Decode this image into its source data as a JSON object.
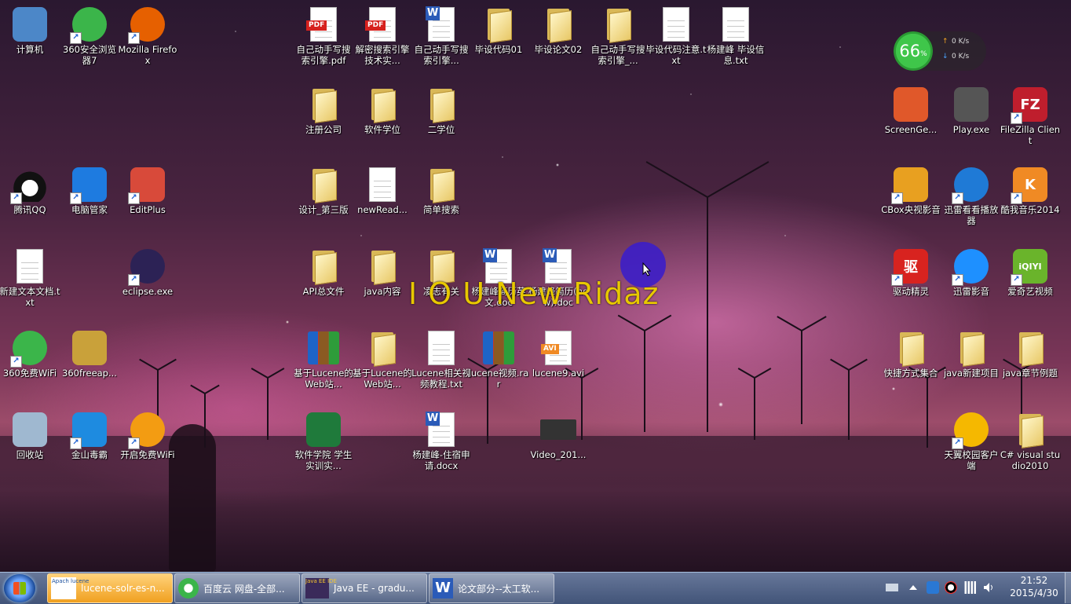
{
  "desktop": {
    "overlay_text": "I O U New Ridaz",
    "left_column": [
      {
        "label": "计算机",
        "icon": "computer-icon",
        "shortcut": false
      },
      {
        "label": "360安全浏览器7",
        "icon": "360-browser-icon",
        "shortcut": true
      },
      {
        "label": "Mozilla Firefox",
        "icon": "firefox-icon",
        "shortcut": true
      },
      {
        "label": "腾讯QQ",
        "icon": "qq-penguin-icon",
        "shortcut": true
      },
      {
        "label": "电脑管家",
        "icon": "tencent-shield-icon",
        "shortcut": true
      },
      {
        "label": "EditPlus",
        "icon": "editplus-icon",
        "shortcut": true
      },
      {
        "label": "新建文本文档.txt",
        "icon": "text-file-icon",
        "shortcut": false
      },
      {
        "label": "eclipse.exe",
        "icon": "eclipse-icon",
        "shortcut": true
      },
      {
        "label": "360免费WiFi",
        "icon": "wifi-icon",
        "shortcut": true
      },
      {
        "label": "360freeap...",
        "icon": "package-icon",
        "shortcut": false
      },
      {
        "label": "回收站",
        "icon": "recycle-bin-icon",
        "shortcut": false
      },
      {
        "label": "金山毒霸",
        "icon": "kingsoft-antivirus-icon",
        "shortcut": true
      },
      {
        "label": "开启免费WiFi",
        "icon": "wifi-orange-icon",
        "shortcut": true
      }
    ],
    "middle": [
      {
        "label": "自己动手写搜索引擎.pdf",
        "icon": "pdf-icon",
        "tag": "PDF"
      },
      {
        "label": "解密搜索引擎技术实...",
        "icon": "pdf-icon",
        "tag": "PDF"
      },
      {
        "label": "自己动手写搜索引擎...",
        "icon": "word-doc-icon",
        "tag": "W"
      },
      {
        "label": "毕设代码01",
        "icon": "folder-icon"
      },
      {
        "label": "毕设论文02",
        "icon": "folder-icon"
      },
      {
        "label": "自己动手写搜索引擎_...",
        "icon": "folder-icon"
      },
      {
        "label": "毕设代码注意.txt",
        "icon": "text-file-icon"
      },
      {
        "label": "杨建峰 毕设信息.txt",
        "icon": "text-file-icon"
      },
      {
        "label": "注册公司",
        "icon": "folder-icon"
      },
      {
        "label": "软件学位",
        "icon": "folder-icon"
      },
      {
        "label": "二学位",
        "icon": "folder-icon"
      },
      {
        "label": "设计_第三版",
        "icon": "folder-icon"
      },
      {
        "label": "newRead...",
        "icon": "text-file-icon"
      },
      {
        "label": "简单搜索",
        "icon": "folder-icon"
      },
      {
        "label": "API总文件",
        "icon": "folder-icon"
      },
      {
        "label": "java内容",
        "icon": "folder-icon"
      },
      {
        "label": "凌志有关",
        "icon": "folder-icon"
      },
      {
        "label": "杨建峰简历英文.doc",
        "icon": "word-doc-icon",
        "tag": "W"
      },
      {
        "label": "杨建峰简历(new).doc",
        "icon": "word-doc-icon",
        "tag": "W"
      },
      {
        "label": "基于Lucene的Web站...",
        "icon": "winrar-icon"
      },
      {
        "label": "基于Lucene的Web站...",
        "icon": "folder-icon"
      },
      {
        "label": "Lucene相关视频教程.txt",
        "icon": "text-file-icon"
      },
      {
        "label": "lucene视频.rar",
        "icon": "winrar-icon"
      },
      {
        "label": "lucene9.avi",
        "icon": "avi-video-icon",
        "tag": "AVI"
      },
      {
        "label": "软件学院 学生实训实...",
        "icon": "excel-icon"
      },
      {
        "label": "杨建峰-住宿申请.docx",
        "icon": "word-doc-icon",
        "tag": "W"
      },
      {
        "label": "Video_201...",
        "icon": "video-thumbnail-icon"
      }
    ],
    "right_column": [
      {
        "label": "ScreenGe...",
        "icon": "puzzle-icon",
        "shortcut": false
      },
      {
        "label": "Play.exe",
        "icon": "video-camera-icon",
        "shortcut": false
      },
      {
        "label": "FileZilla Client",
        "icon": "filezilla-icon",
        "shortcut": true,
        "tag": "FZ"
      },
      {
        "label": "CBox央视影音",
        "icon": "cbox-icon",
        "shortcut": true
      },
      {
        "label": "迅雷看看播放器",
        "icon": "xunlei-player-icon",
        "shortcut": true
      },
      {
        "label": "酷我音乐2014",
        "icon": "kuwo-music-icon",
        "shortcut": true,
        "tag": "K"
      },
      {
        "label": "驱动精灵",
        "icon": "driver-genius-icon",
        "shortcut": true,
        "tag": "驱"
      },
      {
        "label": "迅雷影音",
        "icon": "xunlei-video-icon",
        "shortcut": true
      },
      {
        "label": "爱奇艺视频",
        "icon": "iqiyi-icon",
        "shortcut": true,
        "tag": "iQIYI"
      },
      {
        "label": "快捷方式集合",
        "icon": "folder-icon",
        "shortcut": false
      },
      {
        "label": "java新建项目",
        "icon": "folder-icon",
        "shortcut": false
      },
      {
        "label": "java章节例题",
        "icon": "folder-icon",
        "shortcut": false
      },
      {
        "label": "天翼校园客户端",
        "icon": "tianyi-icon",
        "shortcut": true
      },
      {
        "label": "C# visual studio2010",
        "icon": "folder-icon",
        "shortcut": false
      }
    ]
  },
  "net_monitor": {
    "percent": "66",
    "percent_unit": "%",
    "up": "0 K/s",
    "down": "0 K/s",
    "up_arrow": "↑",
    "down_arrow": "↓"
  },
  "taskbar": {
    "buttons": [
      {
        "label": "lucene-solr-es-n...",
        "icon": "lucene-icon",
        "icon_text": "Apach lucene",
        "active": true
      },
      {
        "label": "百度云 网盘-全部...",
        "icon": "360-browser-icon",
        "active": false
      },
      {
        "label": "Java EE - gradu...",
        "icon": "eclipse-javaee-icon",
        "icon_text": "Java EE IDE",
        "active": false
      },
      {
        "label": "论文部分--太工软...",
        "icon": "word-icon",
        "icon_text": "W",
        "active": false
      }
    ],
    "clock_time": "21:52",
    "clock_date": "2015/4/30"
  }
}
